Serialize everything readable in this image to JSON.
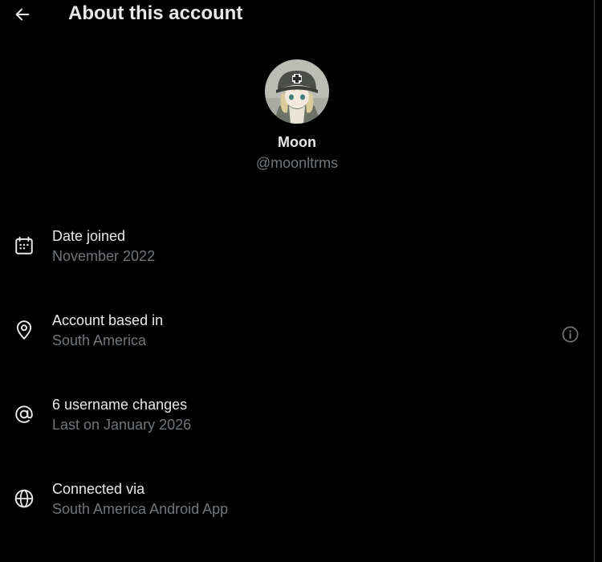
{
  "header": {
    "title": "About this account",
    "back_icon": "arrow-left-icon"
  },
  "profile": {
    "display_name": "Moon",
    "handle": "@moonltrms"
  },
  "rows": [
    {
      "icon": "calendar-icon",
      "label": "Date joined",
      "value": "November 2022"
    },
    {
      "icon": "location-pin-icon",
      "label": "Account based in",
      "value": "South America",
      "action_icon": "info-circle-icon"
    },
    {
      "icon": "at-sign-icon",
      "label": "6 username changes",
      "value": "Last on January 2026"
    },
    {
      "icon": "globe-icon",
      "label": "Connected via",
      "value": "South America Android App"
    }
  ],
  "colors": {
    "background": "#000000",
    "primary_text": "#e7e9ea",
    "secondary_text": "#71767b"
  }
}
